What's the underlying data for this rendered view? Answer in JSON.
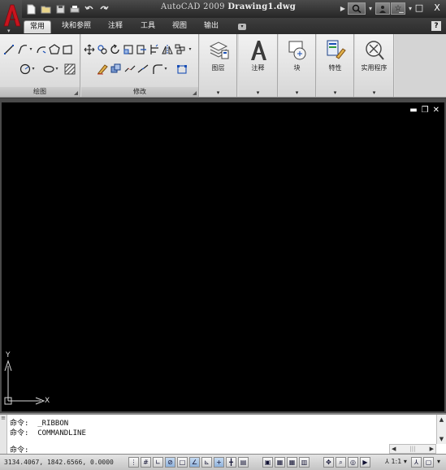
{
  "window": {
    "app_name": "AutoCAD 2009",
    "document": "Drawing1.dwg",
    "controls": [
      "_",
      "□",
      "X"
    ]
  },
  "tabs": [
    "常用",
    "块和参照",
    "注释",
    "工具",
    "视图",
    "输出"
  ],
  "help_label": "?",
  "ribbon": {
    "draw_panel": "绘图",
    "modify_panel": "修改",
    "big_panels": [
      {
        "label": "图层",
        "icon": "layers-icon"
      },
      {
        "label": "注释",
        "icon": "annotation-icon"
      },
      {
        "label": "块",
        "icon": "block-icon"
      },
      {
        "label": "特性",
        "icon": "properties-icon"
      },
      {
        "label": "实用程序",
        "icon": "utilities-icon"
      }
    ]
  },
  "ucs": {
    "x_label": "X",
    "y_label": "Y"
  },
  "command_line": {
    "lines": [
      "命令:  _RIBBON",
      "命令:  COMMANDLINE"
    ],
    "prompt": "命令:"
  },
  "status": {
    "coordinates": "3134.4067,  1842.6566,  0.0000",
    "annotation_scale": "1:1"
  },
  "colors": {
    "canvas": "#000000",
    "titlebar": "#2b2b2b",
    "ribbon": "#e2e2e2",
    "logo_red": "#c8141e"
  }
}
